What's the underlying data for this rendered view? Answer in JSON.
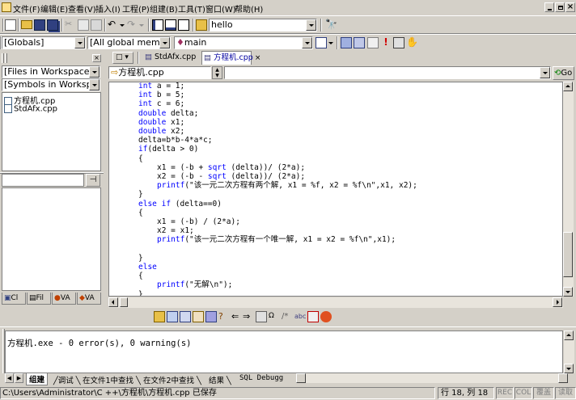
{
  "menu": [
    "文件(F)",
    "编辑(E)",
    "查看(V)",
    "插入(I)",
    "工程(P)",
    "组建(B)",
    "工具(T)",
    "窗口(W)",
    "帮助(H)"
  ],
  "find_combo": {
    "value": "hello"
  },
  "wizard": {
    "class_combo": "[Globals]",
    "members_combo": "[All global members",
    "func_combo": "main"
  },
  "workspace": {
    "files_combo": "[Files in Workspace]",
    "symbols_combo": "[Symbols in Workspace]",
    "files": [
      "方程机.cpp",
      "StdAfx.cpp"
    ],
    "bottom_tabs": [
      "Cl",
      "Fil",
      "VA",
      "VA"
    ]
  },
  "editor": {
    "tabs": [
      "StdAfx.cpp",
      "方程机.cpp"
    ],
    "file_combo": "方程机.cpp",
    "go_label": "Go",
    "lines": [
      {
        "indent": 0,
        "parts": [
          {
            "t": "int",
            "k": 1
          },
          {
            "t": " a = 1;"
          }
        ]
      },
      {
        "indent": 0,
        "parts": [
          {
            "t": "int",
            "k": 1
          },
          {
            "t": " b = 5;"
          }
        ]
      },
      {
        "indent": 0,
        "parts": [
          {
            "t": "int",
            "k": 1
          },
          {
            "t": " c = 6;"
          }
        ]
      },
      {
        "indent": 0,
        "parts": [
          {
            "t": "double",
            "k": 1
          },
          {
            "t": " delta;"
          }
        ]
      },
      {
        "indent": 0,
        "parts": [
          {
            "t": "double",
            "k": 1
          },
          {
            "t": " x1;"
          }
        ]
      },
      {
        "indent": 0,
        "parts": [
          {
            "t": "double",
            "k": 1
          },
          {
            "t": " x2;"
          }
        ]
      },
      {
        "indent": 0,
        "parts": [
          {
            "t": "delta=b*b-4*a*c;"
          }
        ]
      },
      {
        "indent": 0,
        "parts": [
          {
            "t": "if",
            "k": 1
          },
          {
            "t": "(delta > 0)"
          }
        ]
      },
      {
        "indent": 0,
        "parts": [
          {
            "t": "{"
          }
        ]
      },
      {
        "indent": 1,
        "parts": [
          {
            "t": "x1 = (-b + "
          },
          {
            "t": "sqrt",
            "k": 1
          },
          {
            "t": " (delta))/ (2*a);"
          }
        ]
      },
      {
        "indent": 1,
        "parts": [
          {
            "t": "x2 = (-b - "
          },
          {
            "t": "sqrt",
            "k": 1
          },
          {
            "t": " (delta))/ (2*a);"
          }
        ]
      },
      {
        "indent": 1,
        "parts": [
          {
            "t": "printf",
            "k": 1
          },
          {
            "t": "(\"该一元二次方程有两个解, x1 = %f, x2 = %f\\n\",x1, x2);"
          }
        ]
      },
      {
        "indent": 0,
        "parts": [
          {
            "t": "}"
          }
        ]
      },
      {
        "indent": 0,
        "parts": [
          {
            "t": "else if",
            "k": 1
          },
          {
            "t": " (delta==0)"
          }
        ]
      },
      {
        "indent": 0,
        "parts": [
          {
            "t": "{"
          }
        ]
      },
      {
        "indent": 1,
        "parts": [
          {
            "t": "x1 = (-b) / (2*a);"
          }
        ]
      },
      {
        "indent": 1,
        "parts": [
          {
            "t": "x2 = x1;"
          }
        ]
      },
      {
        "indent": 1,
        "parts": [
          {
            "t": "printf",
            "k": 1
          },
          {
            "t": "(\"该一元二次方程有一个唯一解, x1 = x2 = %f\\n\",x1);"
          }
        ]
      },
      {
        "indent": 0,
        "parts": [
          {
            "t": ""
          }
        ]
      },
      {
        "indent": 0,
        "parts": [
          {
            "t": "}"
          }
        ]
      },
      {
        "indent": 0,
        "parts": [
          {
            "t": "else",
            "k": 1
          }
        ]
      },
      {
        "indent": 0,
        "parts": [
          {
            "t": "{"
          }
        ]
      },
      {
        "indent": 1,
        "parts": [
          {
            "t": "printf",
            "k": 1
          },
          {
            "t": "(\"无解\\n\");"
          }
        ]
      },
      {
        "indent": 0,
        "parts": [
          {
            "t": "}"
          }
        ]
      }
    ]
  },
  "output": {
    "text": "方程机.exe - 0 error(s), 0 warning(s)",
    "tabs": [
      "组建",
      "调试",
      "在文件1中查找",
      "在文件2中查找",
      "结果",
      "SQL Debugg"
    ]
  },
  "status": {
    "path": "C:\\Users\\Administrator\\C ++\\方程机\\方程机.cpp 已保存",
    "position": "行 18, 列 18",
    "indicators": [
      "REC",
      "COL",
      "覆盖",
      "读取"
    ]
  }
}
